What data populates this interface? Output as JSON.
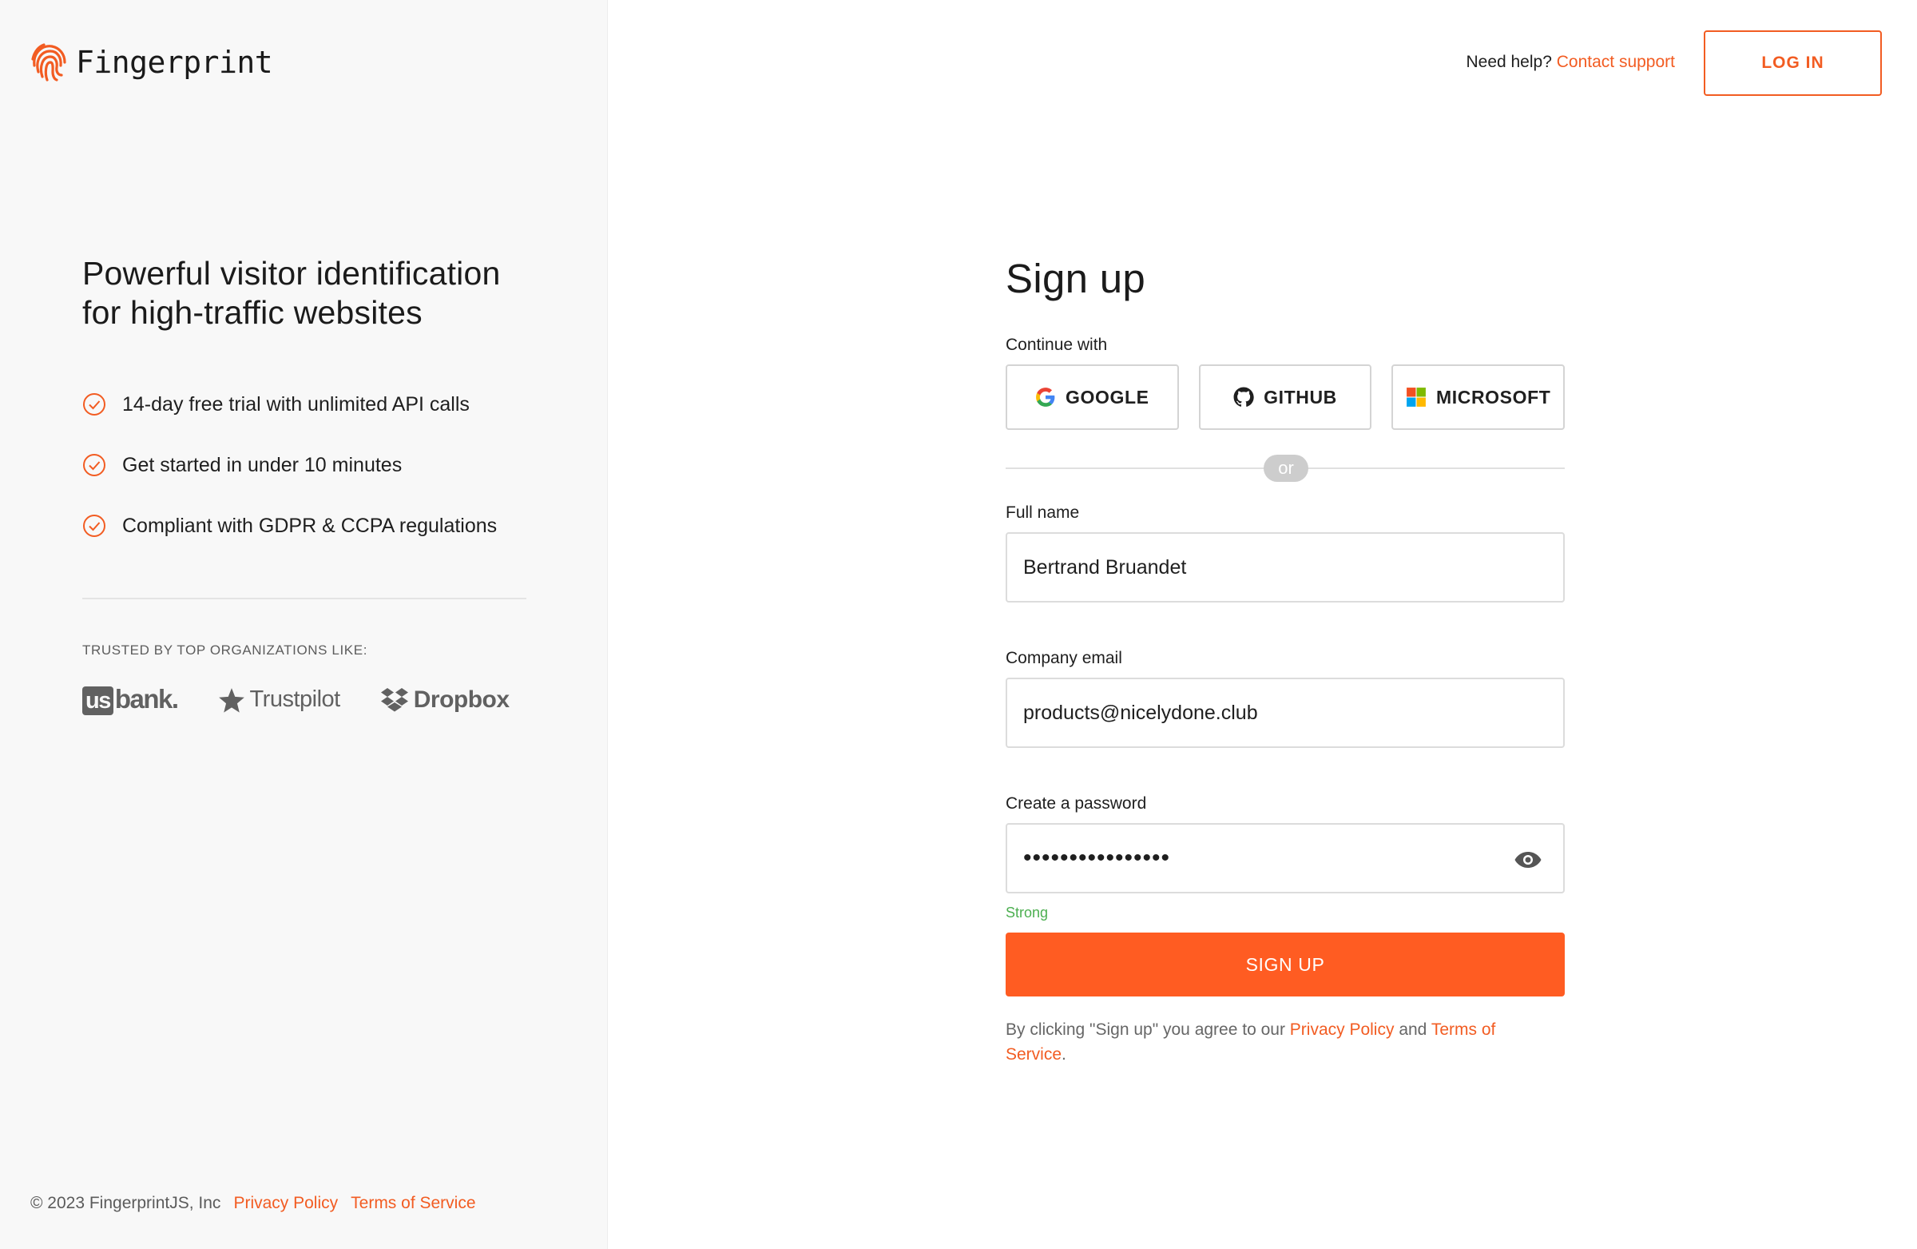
{
  "brand": {
    "name": "Fingerprint",
    "accent": "#f25c22"
  },
  "pitch": {
    "headline_line1": "Powerful visitor identification",
    "headline_line2": "for high-traffic websites",
    "features": [
      {
        "label": "14-day free trial with unlimited API calls",
        "icon": "check-circle-icon"
      },
      {
        "label": "Get started in under 10 minutes",
        "icon": "check-circle-icon"
      },
      {
        "label": "Compliant with GDPR & CCPA regulations",
        "icon": "check-circle-icon"
      }
    ],
    "trusted_label": "TRUSTED BY TOP ORGANIZATIONS LIKE:",
    "logos": {
      "usbank_prefix": "us",
      "usbank_suffix": "bank.",
      "trustpilot": "Trustpilot",
      "dropbox": "Dropbox"
    }
  },
  "footer": {
    "copyright": "© 2023 FingerprintJS, Inc",
    "privacy": "Privacy Policy",
    "terms": "Terms of Service"
  },
  "header": {
    "help_text": "Need help?",
    "contact_link": "Contact support",
    "login_label": "LOG IN"
  },
  "form": {
    "title": "Sign up",
    "continue_with": "Continue with",
    "social": {
      "google": "GOOGLE",
      "github": "GITHUB",
      "microsoft": "MICROSOFT"
    },
    "or_label": "or",
    "full_name": {
      "label": "Full name",
      "value": "Bertrand Bruandet"
    },
    "email": {
      "label": "Company email",
      "value": "products@nicelydone.club"
    },
    "password": {
      "label": "Create a password",
      "value": "••••••••••••••••",
      "strength": "Strong",
      "strength_color": "#4caf50"
    },
    "submit_label": "SIGN UP",
    "submit_color": "#ff5c22",
    "legal": {
      "prefix": "By clicking \"Sign up\" you agree to our",
      "privacy": "Privacy Policy",
      "and": "and",
      "terms": "Terms of Service",
      "suffix": "."
    }
  }
}
